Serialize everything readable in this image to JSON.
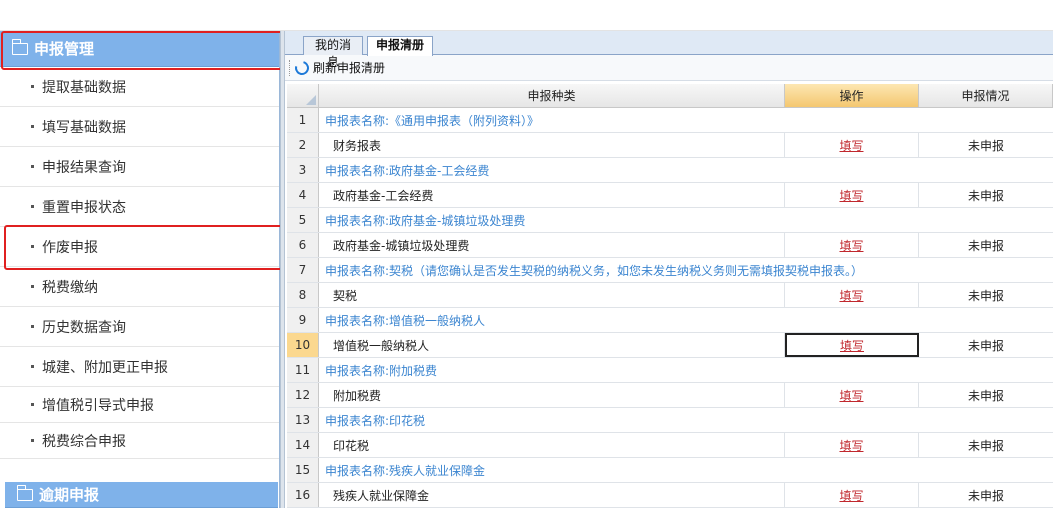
{
  "sidebar": {
    "group1_title": "申报管理",
    "items": [
      {
        "label": "提取基础数据"
      },
      {
        "label": "填写基础数据"
      },
      {
        "label": "申报结果查询"
      },
      {
        "label": "重置申报状态"
      },
      {
        "label": "作废申报"
      },
      {
        "label": "税费缴纳"
      },
      {
        "label": "历史数据查询"
      },
      {
        "label": "城建、附加更正申报"
      },
      {
        "label": "增值税引导式申报"
      },
      {
        "label": "税费综合申报"
      }
    ],
    "group2_title": "逾期申报"
  },
  "tabs": [
    {
      "label": "我的消息"
    },
    {
      "label": "申报清册"
    }
  ],
  "toolbar": {
    "refresh_label": "刷新申报清册"
  },
  "grid": {
    "headers": {
      "type": "申报种类",
      "action": "操作",
      "status": "申报情况"
    },
    "rows": [
      {
        "num": "1",
        "group": "申报表名称:《通用申报表（附列资料）》"
      },
      {
        "num": "2",
        "name": "财务报表",
        "action": "填写",
        "status": "未申报"
      },
      {
        "num": "3",
        "group": "申报表名称:政府基金-工会经费"
      },
      {
        "num": "4",
        "name": "政府基金-工会经费",
        "action": "填写",
        "status": "未申报"
      },
      {
        "num": "5",
        "group": "申报表名称:政府基金-城镇垃圾处理费"
      },
      {
        "num": "6",
        "name": "政府基金-城镇垃圾处理费",
        "action": "填写",
        "status": "未申报"
      },
      {
        "num": "7",
        "group": "申报表名称:契税（请您确认是否发生契税的纳税义务，如您未发生纳税义务则无需填报契税申报表。）"
      },
      {
        "num": "8",
        "name": "契税",
        "action": "填写",
        "status": "未申报"
      },
      {
        "num": "9",
        "group": "申报表名称:增值税一般纳税人"
      },
      {
        "num": "10",
        "name": "增值税一般纳税人",
        "action": "填写",
        "status": "未申报"
      },
      {
        "num": "11",
        "group": "申报表名称:附加税费"
      },
      {
        "num": "12",
        "name": "附加税费",
        "action": "填写",
        "status": "未申报"
      },
      {
        "num": "13",
        "group": "申报表名称:印花税"
      },
      {
        "num": "14",
        "name": "印花税",
        "action": "填写",
        "status": "未申报"
      },
      {
        "num": "15",
        "group": "申报表名称:残疾人就业保障金"
      },
      {
        "num": "16",
        "name": "残疾人就业保障金",
        "action": "填写",
        "status": "未申报"
      }
    ]
  }
}
